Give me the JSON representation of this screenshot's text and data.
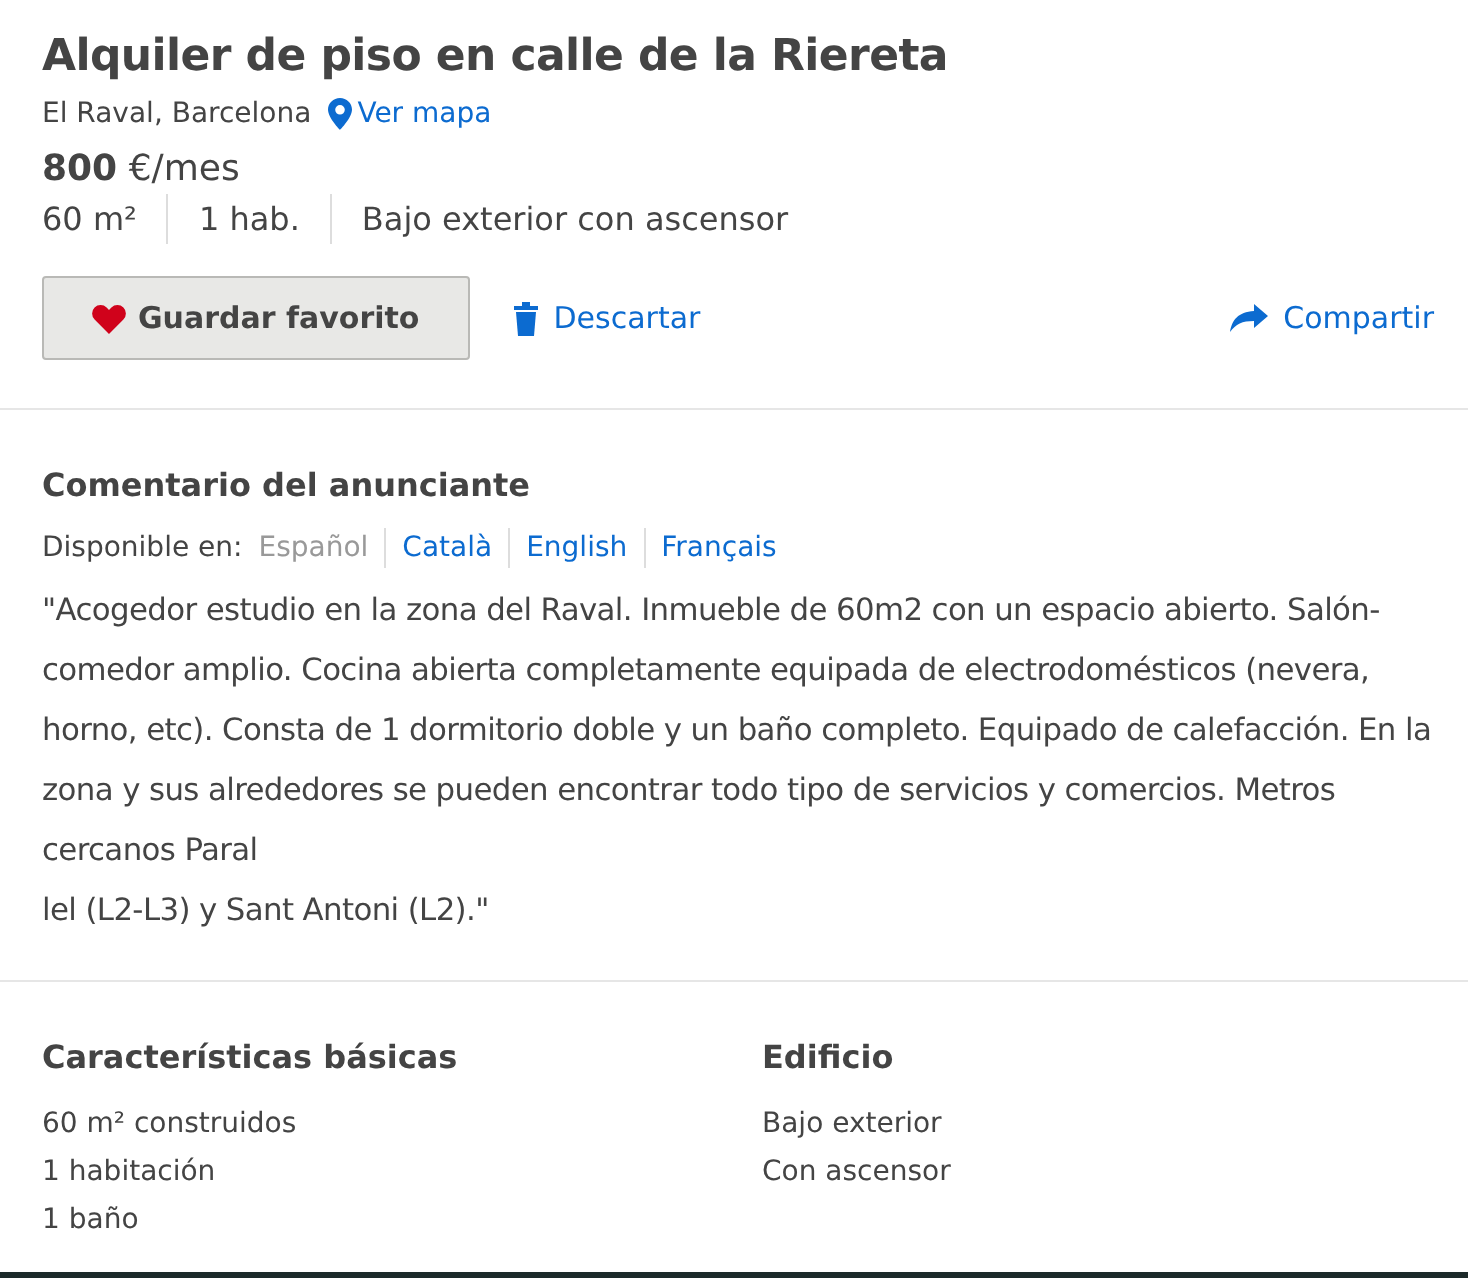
{
  "title": "Alquiler de piso en calle de la Riereta",
  "location": {
    "text": "El Raval, Barcelona",
    "map_link": "Ver mapa"
  },
  "price": {
    "amount": "800",
    "unit": "€/mes"
  },
  "features": [
    "60 m²",
    "1 hab.",
    "Bajo exterior con ascensor"
  ],
  "actions": {
    "favorite": "Guardar favorito",
    "discard": "Descartar",
    "share": "Compartir"
  },
  "comment": {
    "heading": "Comentario del anunciante",
    "languages_label": "Disponible en:",
    "languages": [
      {
        "label": "Español",
        "selected": true
      },
      {
        "label": "Català",
        "selected": false
      },
      {
        "label": "English",
        "selected": false
      },
      {
        "label": "Français",
        "selected": false
      }
    ],
    "text": [
      "\"Acogedor estudio en la zona del Raval. Inmueble de 60m2 con un espacio abierto. Salón-comedor amplio. Cocina abierta completamente equipada de electrodomésticos (nevera, horno, etc). Consta de 1 dormitorio doble y un baño completo. Equipado de calefacción. En la zona y sus alrededores se pueden encontrar todo tipo de servicios y comercios. Metros cercanos Paral",
      "lel (L2-L3) y Sant Antoni (L2).\""
    ]
  },
  "details": [
    {
      "heading": "Características básicas",
      "items": [
        "60 m² construidos",
        "1 habitación",
        "1 baño"
      ]
    },
    {
      "heading": "Edificio",
      "items": [
        "Bajo exterior",
        "Con ascensor"
      ]
    }
  ]
}
